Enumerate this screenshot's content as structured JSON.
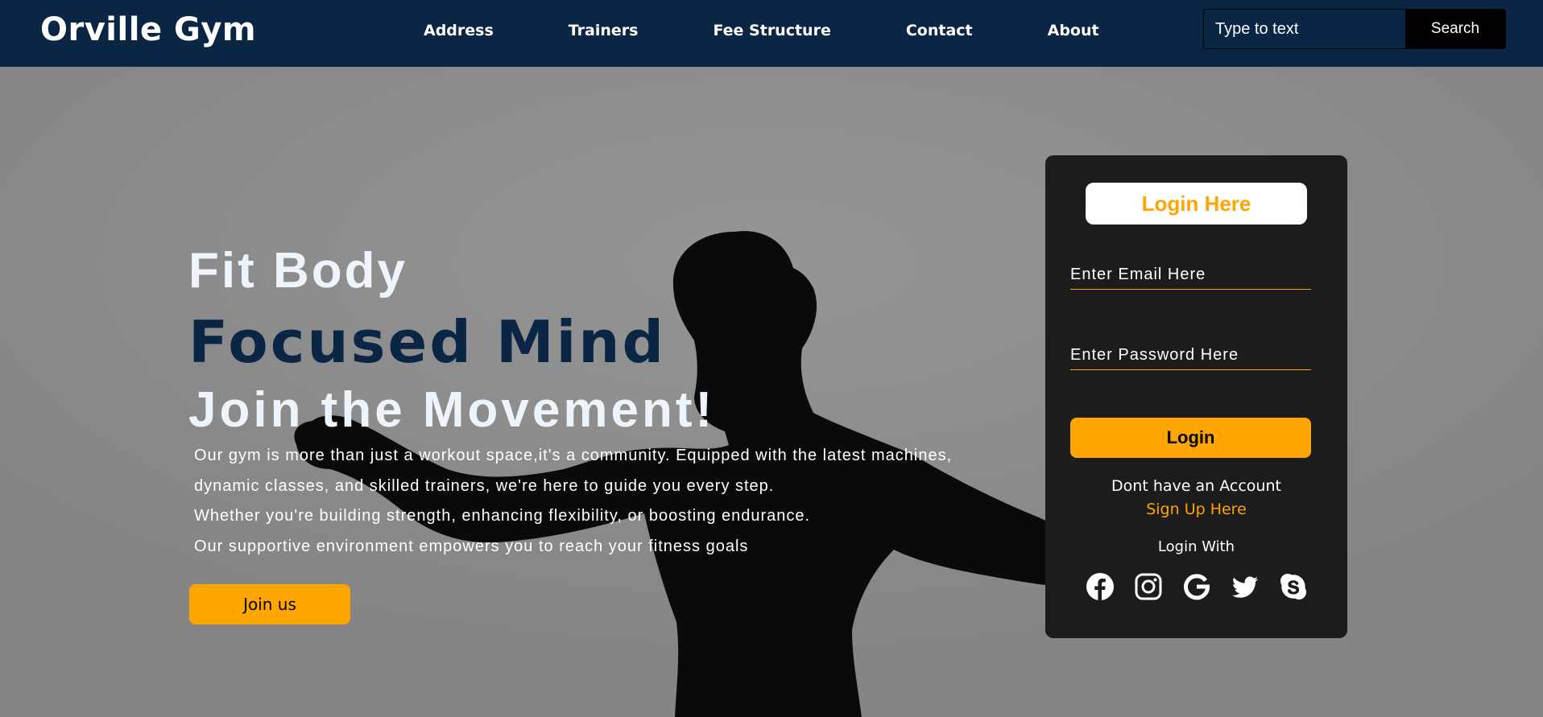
{
  "navbar": {
    "brand": "Orville Gym",
    "links": [
      "Address",
      "Trainers",
      "Fee Structure",
      "Contact",
      "About"
    ],
    "search": {
      "placeholder": "Type to text",
      "button_label": "Search"
    }
  },
  "hero": {
    "line1": "Fit Body",
    "line2": "Focused Mind",
    "line3": "Join the Movement!",
    "description": [
      "Our gym is more than just a workout space,it's a community. Equipped with the latest machines,",
      "dynamic classes, and skilled trainers, we're here to guide you every step.",
      "Whether you're building strength, enhancing flexibility, or boosting endurance.",
      "Our supportive environment empowers you to reach your fitness goals"
    ],
    "cta_label": "Join us"
  },
  "login": {
    "title": "Login Here",
    "email_placeholder": "Enter Email Here",
    "password_placeholder": "Enter Password Here",
    "button_label": "Login",
    "no_account_text": "Dont have an Account",
    "signup_label": "Sign Up Here",
    "login_with_text": "Login With",
    "social_icons": [
      "facebook-icon",
      "instagram-icon",
      "google-icon",
      "twitter-icon",
      "skype-icon"
    ]
  },
  "colors": {
    "navbar_bg": "#0b2545",
    "accent": "#ffa500",
    "card_bg": "#1c1c1c",
    "hero_bg": "#8a8a8a"
  }
}
